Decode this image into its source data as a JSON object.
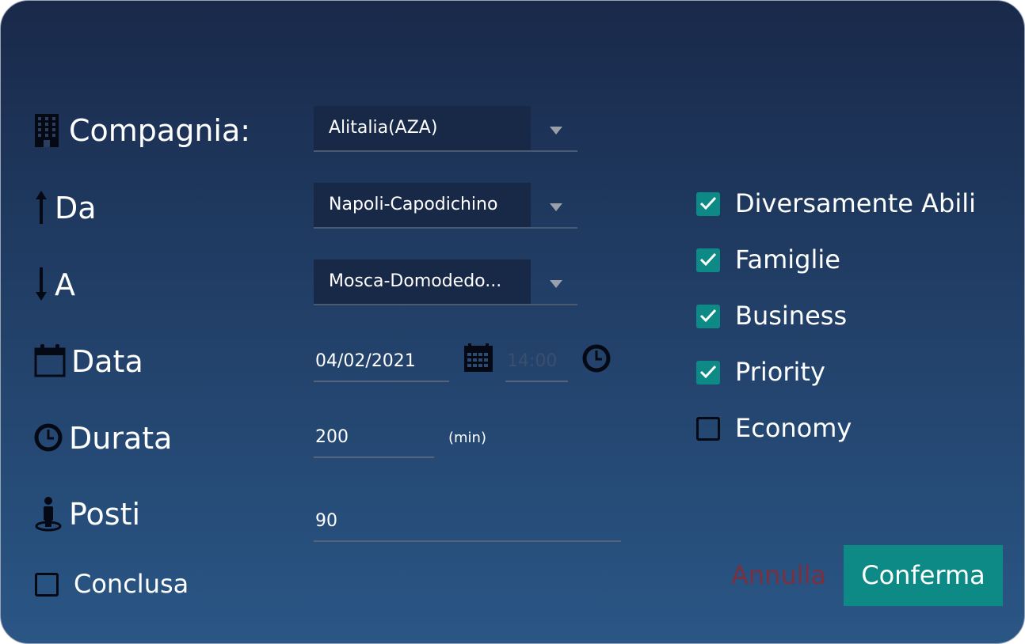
{
  "form": {
    "company": {
      "label": "Compagnia:",
      "icon": "building-icon",
      "value": "Alitalia(AZA)"
    },
    "from": {
      "label": "Da",
      "icon": "arrow-up-icon",
      "value": "Napoli-Capodichino"
    },
    "to": {
      "label": "A",
      "icon": "arrow-down-icon",
      "value": "Mosca-Domodedo..."
    },
    "date": {
      "label": "Data",
      "icon": "calendar-icon",
      "value": "04/02/2021",
      "time_value": "14:00"
    },
    "duration": {
      "label": "Durata",
      "icon": "clock-icon",
      "value": "200",
      "unit": "(min)"
    },
    "seats": {
      "label": "Posti",
      "icon": "person-pin-icon",
      "value": "90"
    },
    "completed": {
      "label": "Conclusa",
      "checked": false
    }
  },
  "options": [
    {
      "label": "Diversamente Abili",
      "checked": true
    },
    {
      "label": "Famiglie",
      "checked": true
    },
    {
      "label": "Business",
      "checked": true
    },
    {
      "label": "Priority",
      "checked": true
    },
    {
      "label": "Economy",
      "checked": false
    }
  ],
  "actions": {
    "cancel_label": "Annulla",
    "confirm_label": "Conferma"
  },
  "colors": {
    "accent": "#0e8a86",
    "cancel": "#7a3040",
    "background_top": "#19294a",
    "background_bottom": "#2a5685"
  }
}
